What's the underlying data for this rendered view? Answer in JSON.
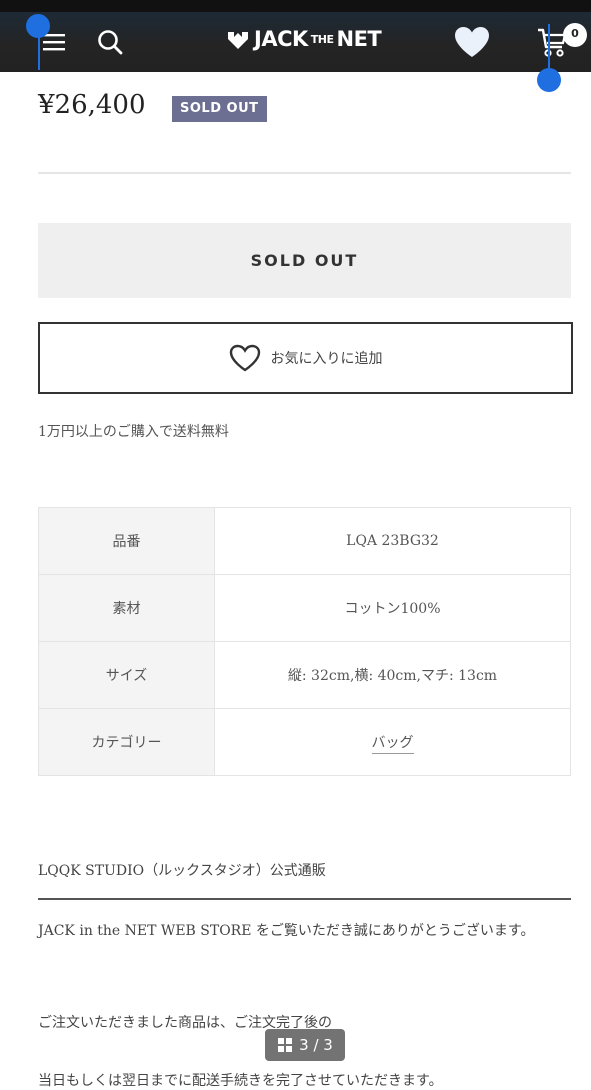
{
  "header": {
    "logo_left": "JACK",
    "logo_mid": "THE",
    "logo_right": "NET",
    "cart_count": "0"
  },
  "product": {
    "price": "¥26,400",
    "status_badge": "SOLD OUT",
    "soldout_button": "SOLD OUT",
    "favorite_button": "お気に入りに追加",
    "shipping_note": "1万円以上のご購入で送料無料"
  },
  "specs": [
    {
      "label": "品番",
      "value": "LQA 23BG32"
    },
    {
      "label": "素材",
      "value": "コットン100%"
    },
    {
      "label": "サイズ",
      "value": "縦: 32cm,横: 40cm,マチ: 13cm"
    },
    {
      "label": "カテゴリー",
      "value": "バッグ"
    }
  ],
  "description": {
    "title": "LQQK STUDIO（ルックスタジオ）公式通販",
    "paragraph1": "JACK in the NET WEB STORE をご覧いただき誠にありがとうございます。",
    "paragraph2": "ご注文いただきました商品は、ご注文完了後の",
    "paragraph3": "当日もしくは翌日までに配送手続きを完了させていただきます。"
  },
  "pager": {
    "text": "3 / 3"
  },
  "icons": [
    "menu-icon",
    "search-icon",
    "logo-icon",
    "wishlist-heart-icon",
    "cart-icon",
    "heart-outline-icon",
    "gallery-icon"
  ],
  "colors": {
    "header": "#222222",
    "badge": "#6c6f91",
    "overlay_dot": "#1f6fe0"
  }
}
